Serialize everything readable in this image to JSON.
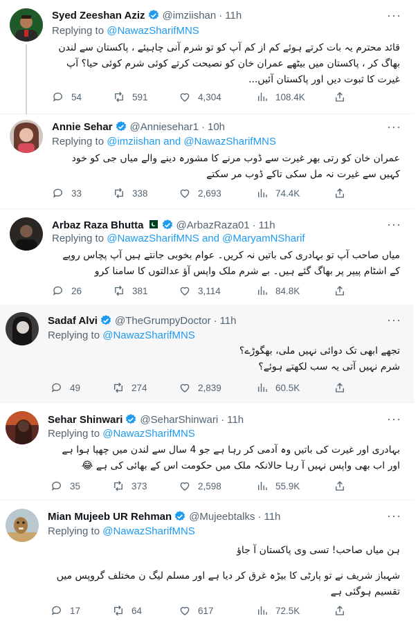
{
  "colors": {
    "accent": "#1d9bf0",
    "text": "#0f1419",
    "muted": "#536471",
    "highlight_bg": "#f7f7f7"
  },
  "icons": {
    "reply": "speech-bubble-icon",
    "retweet": "retweet-arrows-icon",
    "like": "heart-icon",
    "views": "bar-chart-icon",
    "share": "share-upload-icon",
    "more": "ellipsis-icon",
    "verified": "verified-badge-icon"
  },
  "tweets": [
    {
      "name": "Syed Zeeshan Aziz",
      "handle": "@imziishan",
      "time": "11h",
      "sep": "·",
      "replying_label": "Replying to",
      "mentions": "@NawazSharifMNS",
      "text": "قائد محترم یہ بات کرتے ہوئے کم از کم آپ کو تو شرم آنی چاہیئے ، پاکستان سے لندن بھاگ کر ، پاکستان میں بیٹھے عمران خان کو نصیحت کرتے کوئی شرم کوئی حیا؟ آپ غیرت کا ثبوت دیں اور پاکستان آئیں...",
      "replies": "54",
      "retweets": "591",
      "likes": "4,304",
      "views": "108.4K"
    },
    {
      "name": "Annie Sehar",
      "handle": "@Anniesehar1",
      "time": "10h",
      "sep": "·",
      "replying_label": "Replying to",
      "mentions": "@imziishan and @NawazSharifMNS",
      "text": "عمران خان کو رتی بھر غیرت سے ڈوب مرنے کا مشورہ دینے والے میاں جی کو خود کہیں سے غیرت نہ مل سکی تاکے ڈوب مر سکتے",
      "replies": "33",
      "retweets": "338",
      "likes": "2,693",
      "views": "74.4K"
    },
    {
      "name": "Arbaz Raza Bhutta",
      "flag": "🇵🇰",
      "handle": "@ArbazRaza01",
      "time": "11h",
      "sep": "·",
      "replying_label": "Replying to",
      "mentions": "@NawazSharifMNS and @MaryamNSharif",
      "text": "میاں صاحب آپ تو بہادری کی باتیں نہ کریں۔ عوام بخوبی جانتے ہیں آپ پچاس روپے کے اشٹام پیپر پر بھاگ گئے ہیں۔ بے شرم ملک واپس آؤ عدالتوں کا سامنا کرو",
      "replies": "26",
      "retweets": "381",
      "likes": "3,114",
      "views": "84.8K"
    },
    {
      "name": "Sadaf Alvi",
      "handle": "@TheGrumpyDoctor",
      "time": "11h",
      "sep": "·",
      "replying_label": "Replying to",
      "mentions": "@NawazSharifMNS",
      "text_lines": [
        "تجھے ابھی تک دوائی نہیں ملی، بھگوڑے؟",
        "شرم نہیں آتی یہ سب لکھتے ہوئے؟"
      ],
      "replies": "49",
      "retweets": "274",
      "likes": "2,839",
      "views": "60.5K"
    },
    {
      "name": "Sehar Shinwari",
      "handle": "@SeharShinwari",
      "time": "11h",
      "sep": "·",
      "replying_label": "Replying to",
      "mentions": "@NawazSharifMNS",
      "text": "بہادری اور غیرت کی باتیں وہ آدمی کر رہا ہے جو 4 سال سے لندن میں چھپا ہوا ہے اور اب بھی واپس نہیں آ رہا حالانکہ ملک میں حکومت اس کے بھائی کی ہے 😂",
      "replies": "35",
      "retweets": "373",
      "likes": "2,598",
      "views": "55.9K"
    },
    {
      "name": "Mian Mujeeb UR Rehman",
      "handle": "@Mujeebtalks",
      "time": "11h",
      "sep": "·",
      "replying_label": "Replying to",
      "mentions": "@NawazSharifMNS",
      "text_lines": [
        "ہن میاں صاحب! تسی وی پاکستان آ جاؤ",
        "",
        "شہباز شریف نے تو پارٹی کا بیڑہ غرق کر دیا ہے اور مسلم لیگ ن مختلف گروپس میں تقسیم ہوگئی ہے"
      ],
      "replies": "17",
      "retweets": "64",
      "likes": "617",
      "views": "72.5K"
    }
  ]
}
